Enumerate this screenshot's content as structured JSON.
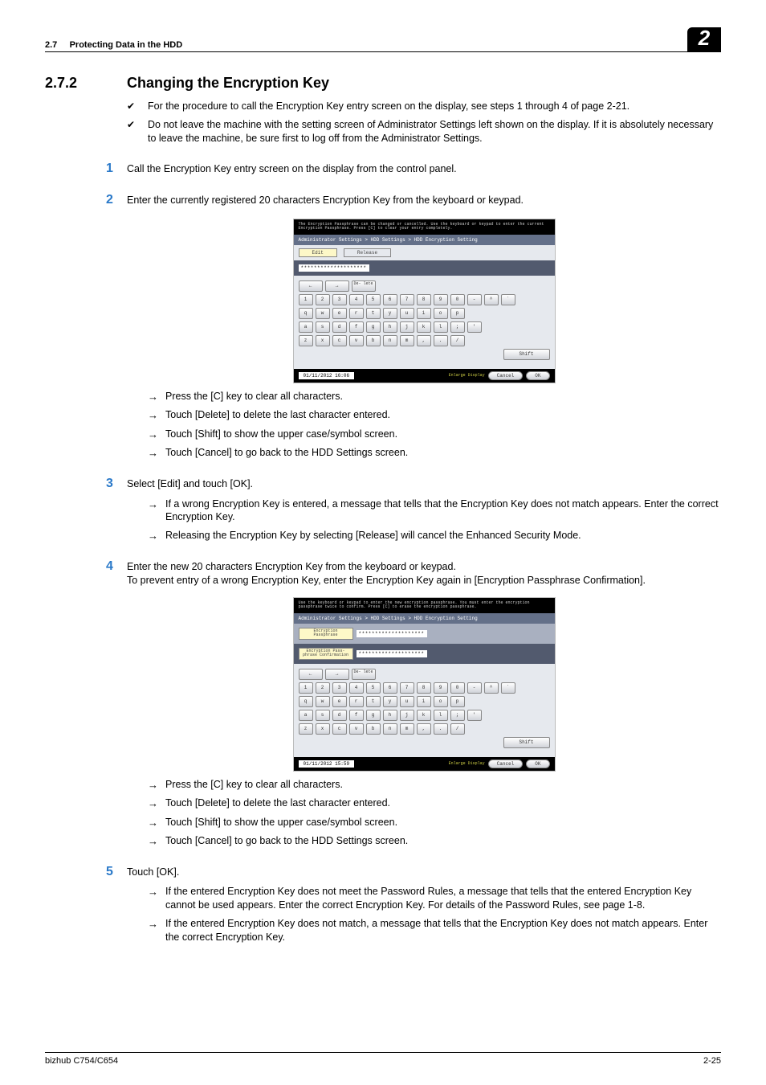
{
  "header": {
    "section_ref": "2.7",
    "section_name": "Protecting Data in the HDD",
    "chapter_badge": "2"
  },
  "title": {
    "number": "2.7.2",
    "text": "Changing the Encryption Key"
  },
  "checks": [
    "For the procedure to call the Encryption Key entry screen on the display, see steps 1 through 4 of page 2-21.",
    "Do not leave the machine with the setting screen of Administrator Settings left shown on the display. If it is absolutely necessary to leave the machine, be sure first to log off from the Administrator Settings."
  ],
  "steps": {
    "s1": "Call the Encryption Key entry screen on the display from the control panel.",
    "s2": "Enter the currently registered 20 characters Encryption Key from the keyboard or keypad.",
    "s3": "Select [Edit] and touch [OK].",
    "s4_a": "Enter the new 20 characters Encryption Key from the keyboard or keypad.",
    "s4_b": "To prevent entry of a wrong Encryption Key, enter the Encryption Key again in [Encryption Passphrase Confirmation].",
    "s5": "Touch [OK]."
  },
  "arrows_a": [
    "Press the [C] key to clear all characters.",
    "Touch [Delete] to delete the last character entered.",
    "Touch [Shift] to show the upper case/symbol screen.",
    "Touch [Cancel] to go back to the HDD Settings screen."
  ],
  "arrows_b": [
    "If a wrong Encryption Key is entered, a message that tells that the Encryption Key does not match appears. Enter the correct Encryption Key.",
    "Releasing the Encryption Key by selecting [Release] will cancel the Enhanced Security Mode."
  ],
  "arrows_c": [
    "Press the [C] key to clear all characters.",
    "Touch [Delete] to delete the last character entered.",
    "Touch [Shift] to show the upper case/symbol screen.",
    "Touch [Cancel] to go back to the HDD Settings screen."
  ],
  "arrows_d": [
    "If the entered Encryption Key does not meet the Password Rules, a message that tells that the entered Encryption Key cannot be used appears. Enter the correct Encryption Key. For details of the Password Rules, see page 1-8.",
    "If the entered Encryption Key does not match, a message that tells that the Encryption Key does not match appears. Enter the correct Encryption Key."
  ],
  "screenshot1": {
    "top_msg": "The Encryption Passphrase can be changed or cancelled. Use the keyboard or keypad to enter the current Encryption Passphrase. Press [C] to clear your entry completely.",
    "breadcrumb": "Administrator Settings > HDD Settings > HDD Encryption Setting",
    "tab1": "Edit",
    "tab2": "Release",
    "input_val": "********************",
    "delete": "De-\nlete",
    "shift": "Shift",
    "date": "01/11/2012   16:06",
    "enlarge": "Enlarge\nDisplay",
    "cancel": "Cancel",
    "ok": "OK",
    "row1": [
      "1",
      "2",
      "3",
      "4",
      "5",
      "6",
      "7",
      "8",
      "9",
      "0",
      "-",
      "^",
      "`"
    ],
    "row2": [
      "q",
      "w",
      "e",
      "r",
      "t",
      "y",
      "u",
      "i",
      "o",
      "p"
    ],
    "row3": [
      "a",
      "s",
      "d",
      "f",
      "g",
      "h",
      "j",
      "k",
      "l",
      ";",
      "'"
    ],
    "row4": [
      "z",
      "x",
      "c",
      "v",
      "b",
      "n",
      "m",
      ",",
      ".",
      "/"
    ]
  },
  "screenshot2": {
    "top_msg": "Use the keyboard or keypad to enter the new encryption passphrase. You must enter the encryption passphrase twice to confirm. Press [C] to erase the encryption passphrase.",
    "breadcrumb": "Administrator Settings > HDD Settings > HDD Encryption Setting",
    "label1": "Encryption\nPassphrase",
    "label2": "Encryption Pass-\nphrase Confirmation",
    "input_val": "********************",
    "delete": "De-\nlete",
    "shift": "Shift",
    "date": "01/11/2012   15:59",
    "enlarge": "Enlarge\nDisplay",
    "cancel": "Cancel",
    "ok": "OK",
    "row1": [
      "1",
      "2",
      "3",
      "4",
      "5",
      "6",
      "7",
      "8",
      "9",
      "0",
      "-",
      "^",
      "`"
    ],
    "row2": [
      "q",
      "w",
      "e",
      "r",
      "t",
      "y",
      "u",
      "i",
      "o",
      "p"
    ],
    "row3": [
      "a",
      "s",
      "d",
      "f",
      "g",
      "h",
      "j",
      "k",
      "l",
      ";",
      "'"
    ],
    "row4": [
      "z",
      "x",
      "c",
      "v",
      "b",
      "n",
      "m",
      ",",
      ".",
      "/"
    ]
  },
  "footer": {
    "left": "bizhub C754/C654",
    "right": "2-25"
  }
}
